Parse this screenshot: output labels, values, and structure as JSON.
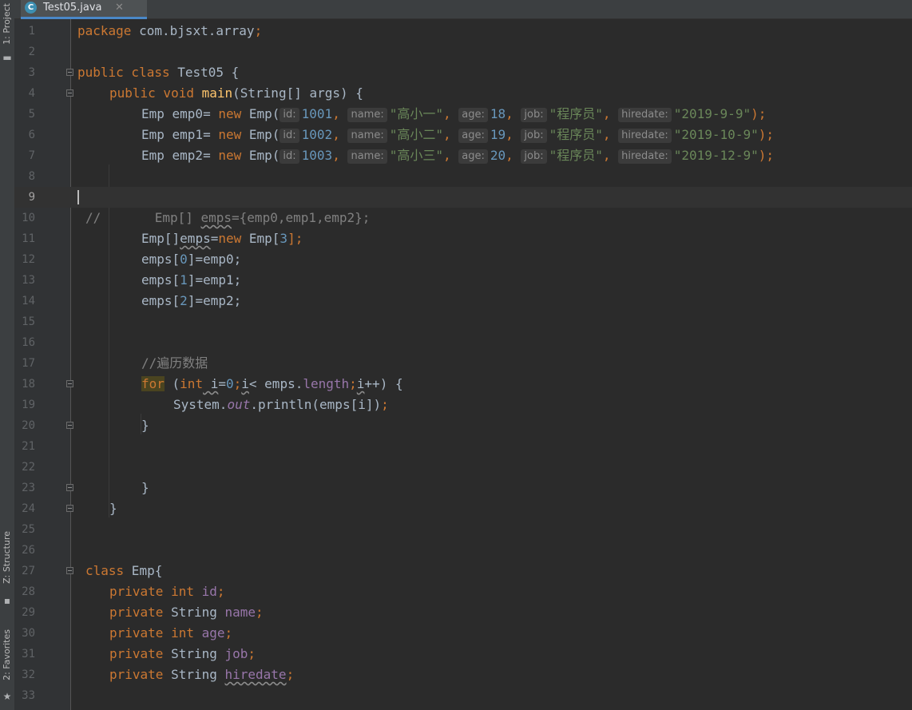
{
  "sidebar": {
    "project_label": "1: Project",
    "structure_label": "Z: Structure",
    "favorites_label": "2: Favorites"
  },
  "tab": {
    "file_name": "Test05.java",
    "icon_letter": "C",
    "close_glyph": "✕"
  },
  "editor": {
    "current_line": 9,
    "lines": [
      {
        "n": "1"
      },
      {
        "n": "2"
      },
      {
        "n": "3"
      },
      {
        "n": "4"
      },
      {
        "n": "5"
      },
      {
        "n": "6"
      },
      {
        "n": "7"
      },
      {
        "n": "8"
      },
      {
        "n": "9"
      },
      {
        "n": "10"
      },
      {
        "n": "11"
      },
      {
        "n": "12"
      },
      {
        "n": "13"
      },
      {
        "n": "14"
      },
      {
        "n": "15"
      },
      {
        "n": "16"
      },
      {
        "n": "17"
      },
      {
        "n": "18"
      },
      {
        "n": "19"
      },
      {
        "n": "20"
      },
      {
        "n": "21"
      },
      {
        "n": "22"
      },
      {
        "n": "23"
      },
      {
        "n": "24"
      },
      {
        "n": "25"
      },
      {
        "n": "26"
      },
      {
        "n": "27"
      },
      {
        "n": "28"
      },
      {
        "n": "29"
      },
      {
        "n": "30"
      },
      {
        "n": "31"
      },
      {
        "n": "32"
      },
      {
        "n": "33"
      }
    ],
    "code": {
      "l1": {
        "kw": "package",
        "rest": " com.bjsxt.array",
        "semi": ";"
      },
      "l3": {
        "kw": "public class",
        "name": " Test05 {"
      },
      "l4": {
        "kw1": "public void",
        "fn": "main",
        "rest": "(String[] args) {"
      },
      "l5": {
        "pre": "Emp emp0= ",
        "kw": "new",
        "cls": " Emp(",
        "h_id": "id:",
        "id": "1001",
        "h_name": "name:",
        "name": "\"高小一\"",
        "h_age": "age:",
        "age": "18",
        "h_job": "job:",
        "job": "\"程序员\"",
        "h_hire": "hiredate:",
        "hire": "\"2019-9-9\"",
        "end": ");"
      },
      "l6": {
        "pre": "Emp emp1= ",
        "kw": "new",
        "cls": " Emp(",
        "h_id": "id:",
        "id": "1002",
        "h_name": "name:",
        "name": "\"高小二\"",
        "h_age": "age:",
        "age": "19",
        "h_job": "job:",
        "job": "\"程序员\"",
        "h_hire": "hiredate:",
        "hire": "\"2019-10-9\"",
        "end": ");"
      },
      "l7": {
        "pre": "Emp emp2= ",
        "kw": "new",
        "cls": " Emp(",
        "h_id": "id:",
        "id": "1003",
        "h_name": "name:",
        "name": "\"高小三\"",
        "h_age": "age:",
        "age": "20",
        "h_job": "job:",
        "job": "\"程序员\"",
        "h_hire": "hiredate:",
        "hire": "\"2019-12-9\"",
        "end": ");"
      },
      "l10": {
        "slashes": "//",
        "body": "       Emp[] ",
        "var": "emps",
        "rest": "={emp0,emp1,emp2};"
      },
      "l11": {
        "pre": "Emp[]",
        "var": "emps",
        "eq": "=",
        "kw": "new",
        "cls": " Emp[",
        "num": "3",
        "end": "];"
      },
      "l12": {
        "a": "emps[",
        "n": "0",
        "b": "]=emp0;"
      },
      "l13": {
        "a": "emps[",
        "n": "1",
        "b": "]=emp1;"
      },
      "l14": {
        "a": "emps[",
        "n": "2",
        "b": "]=emp2;"
      },
      "l17": {
        "comment": "//遍历数据"
      },
      "l18": {
        "kw": "for",
        "p1": " (",
        "kw2": "int",
        "v1": " i",
        "eq": "=",
        "zero": "0",
        "semi": ";",
        "v2": "i",
        "mid": "< emps.",
        "len": "length",
        "semi2": ";",
        "v3": "i",
        "end": "++) {"
      },
      "l19": {
        "sys": "System.",
        "out": "out",
        "rest": ".println(emps[i])",
        "semi": ";"
      },
      "l20": {
        "brace": "}"
      },
      "l23": {
        "brace": "}"
      },
      "l24": {
        "brace": "}"
      },
      "l27": {
        "kw": "class",
        "name": " Emp{"
      },
      "l28": {
        "kw": "private int",
        "field": " id",
        "semi": ";"
      },
      "l29": {
        "kw": "private",
        "type": " String",
        "field": " name",
        "semi": ";"
      },
      "l30": {
        "kw": "private int",
        "field": " age",
        "semi": ";"
      },
      "l31": {
        "kw": "private",
        "type": " String",
        "field": " job",
        "semi": ";"
      },
      "l32": {
        "kw": "private",
        "type": " String ",
        "field": "hiredate",
        "semi": ";"
      }
    }
  }
}
